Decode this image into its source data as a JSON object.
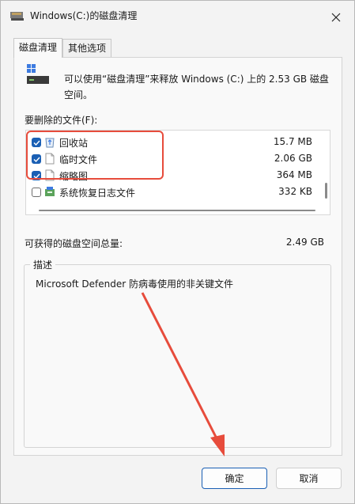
{
  "window": {
    "title": "Windows(C:)的磁盘清理"
  },
  "tabs": [
    {
      "label": "磁盘清理"
    },
    {
      "label": "其他选项"
    }
  ],
  "main": {
    "description": "可以使用“磁盘清理”来释放 Windows (C:) 上的 2.53 GB 磁盘空间。",
    "files_label": "要删除的文件(F):",
    "files": [
      {
        "name": "回收站",
        "size": "15.7 MB",
        "checked": true
      },
      {
        "name": "临时文件",
        "size": "2.06 GB",
        "checked": true
      },
      {
        "name": "缩略图",
        "size": "364 MB",
        "checked": true
      },
      {
        "name": "系统恢复日志文件",
        "size": "332 KB",
        "checked": false
      }
    ],
    "total_label": "可获得的磁盘空间总量:",
    "total_value": "2.49 GB",
    "group_title": "描述",
    "group_description": "Microsoft Defender 防病毒使用的非关键文件"
  },
  "buttons": {
    "ok": "确定",
    "cancel": "取消"
  },
  "colors": {
    "accent": "#1a5fb4",
    "annotation": "#e74c3c"
  }
}
